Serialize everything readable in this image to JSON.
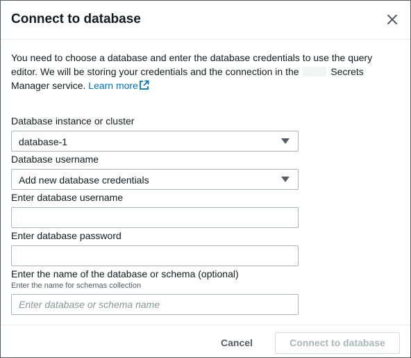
{
  "modal": {
    "title": "Connect to database",
    "intro_part1": "You need to choose a database and enter the database credentials to use the query editor. We will be storing your credentials and the connection in the",
    "intro_part2": "Secrets Manager service.",
    "learn_more": "Learn more"
  },
  "fields": {
    "instance": {
      "label": "Database instance or cluster",
      "value": "database-1"
    },
    "username_mode": {
      "label": "Database username",
      "value": "Add new database credentials"
    },
    "username": {
      "label": "Enter database username",
      "value": "",
      "placeholder": ""
    },
    "password": {
      "label": "Enter database password",
      "value": "",
      "placeholder": ""
    },
    "schema": {
      "label": "Enter the name of the database or schema (optional)",
      "description": "Enter the name for schemas collection",
      "placeholder": "Enter database or schema name"
    }
  },
  "footer": {
    "cancel": "Cancel",
    "connect": "Connect to database"
  },
  "colors": {
    "link": "#0073bb",
    "disabled_text": "#aab7b8",
    "border": "#aab7b8"
  },
  "icons": [
    "close-icon",
    "external-link-icon",
    "caret-down-icon"
  ]
}
